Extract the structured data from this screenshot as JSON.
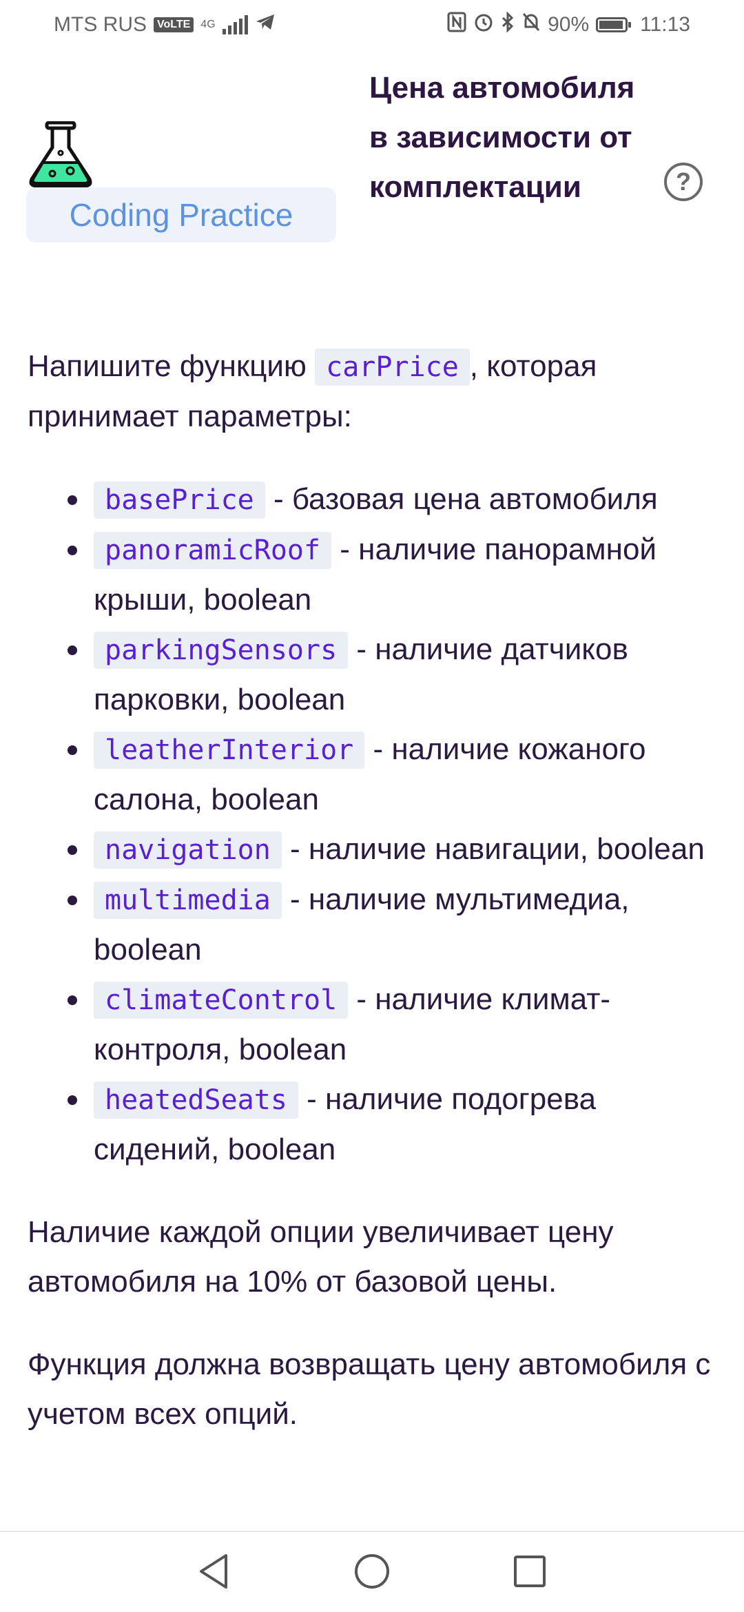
{
  "status_bar": {
    "carrier": "MTS RUS",
    "volte": "VoLTE",
    "network": "4G",
    "battery_percent": "90%",
    "time": "11:13",
    "icons": [
      "telegram-icon",
      "nfc-icon",
      "alarm-icon",
      "bluetooth-icon",
      "mute-icon",
      "battery-icon"
    ]
  },
  "header": {
    "badge_label": "Coding Practice",
    "title": "Цена автомобиля в зависимости от комплектации",
    "help_symbol": "?"
  },
  "content": {
    "intro_before": "Напишите функцию ",
    "function_name": "carPrice",
    "intro_after": ", которая принимает параметры:",
    "params": [
      {
        "name": "basePrice",
        "desc": " - базовая цена автомобиля"
      },
      {
        "name": "panoramicRoof",
        "desc": " - наличие панорамной крыши, boolean"
      },
      {
        "name": "parkingSensors",
        "desc": " - наличие датчиков парковки, boolean"
      },
      {
        "name": "leatherInterior",
        "desc": " - наличие кожаного салона, boolean"
      },
      {
        "name": "navigation",
        "desc": " - наличие навигации, boolean"
      },
      {
        "name": "multimedia",
        "desc": " - наличие мультимедиа, boolean"
      },
      {
        "name": "climateControl",
        "desc": " - наличие климат-контроля, boolean"
      },
      {
        "name": "heatedSeats",
        "desc": " - наличие подогрева сидений, boolean"
      }
    ],
    "paragraph_2": "Наличие каждой опции увеличивает цену автомобиля на 10% от базовой цены.",
    "paragraph_3": "Функция должна возвращать цену автомобиля с учетом всех опций."
  },
  "colors": {
    "badge_text": "#5d93de",
    "badge_bg": "#eef3fb",
    "code_text": "#5a1fd1",
    "code_bg": "#e9eff5",
    "title_text": "#2d1642",
    "flask_liquid": "#3ee6a0"
  }
}
